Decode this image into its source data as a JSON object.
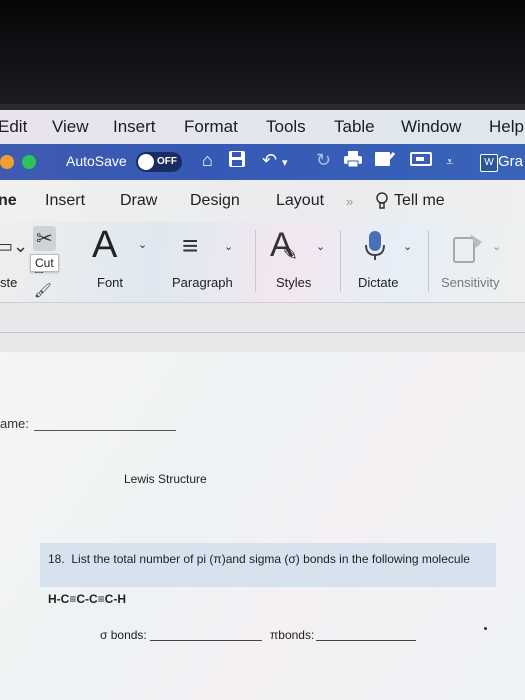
{
  "menu": [
    "Edit",
    "View",
    "Insert",
    "Format",
    "Tools",
    "Table",
    "Window",
    "Help"
  ],
  "titlebar": {
    "autosave_label": "AutoSave",
    "toggle_state": "OFF",
    "doc_name_partial": "Gra"
  },
  "tabs": [
    "ne",
    "Insert",
    "Draw",
    "Design",
    "Layout",
    "Tell me"
  ],
  "ribbon": {
    "paste_partial": "ste",
    "cut_tooltip": "Cut",
    "font": "Font",
    "paragraph": "Paragraph",
    "styles": "Styles",
    "dictate": "Dictate",
    "sensitivity": "Sensitivity"
  },
  "document": {
    "name_label": "ame:",
    "lewis_heading": "Lewis Structure",
    "q_number": "18.",
    "question": "List the total number of pi (π)and sigma (σ) bonds in the following molecule",
    "molecule": "H-C≡C-C≡C-H",
    "sigma_label": "σ bonds:",
    "pi_label": "πbonds:"
  },
  "colors": {
    "titlebar_blue": "#3559b5",
    "close_dot": "#e0463c",
    "green_dot": "#2fc45a"
  }
}
